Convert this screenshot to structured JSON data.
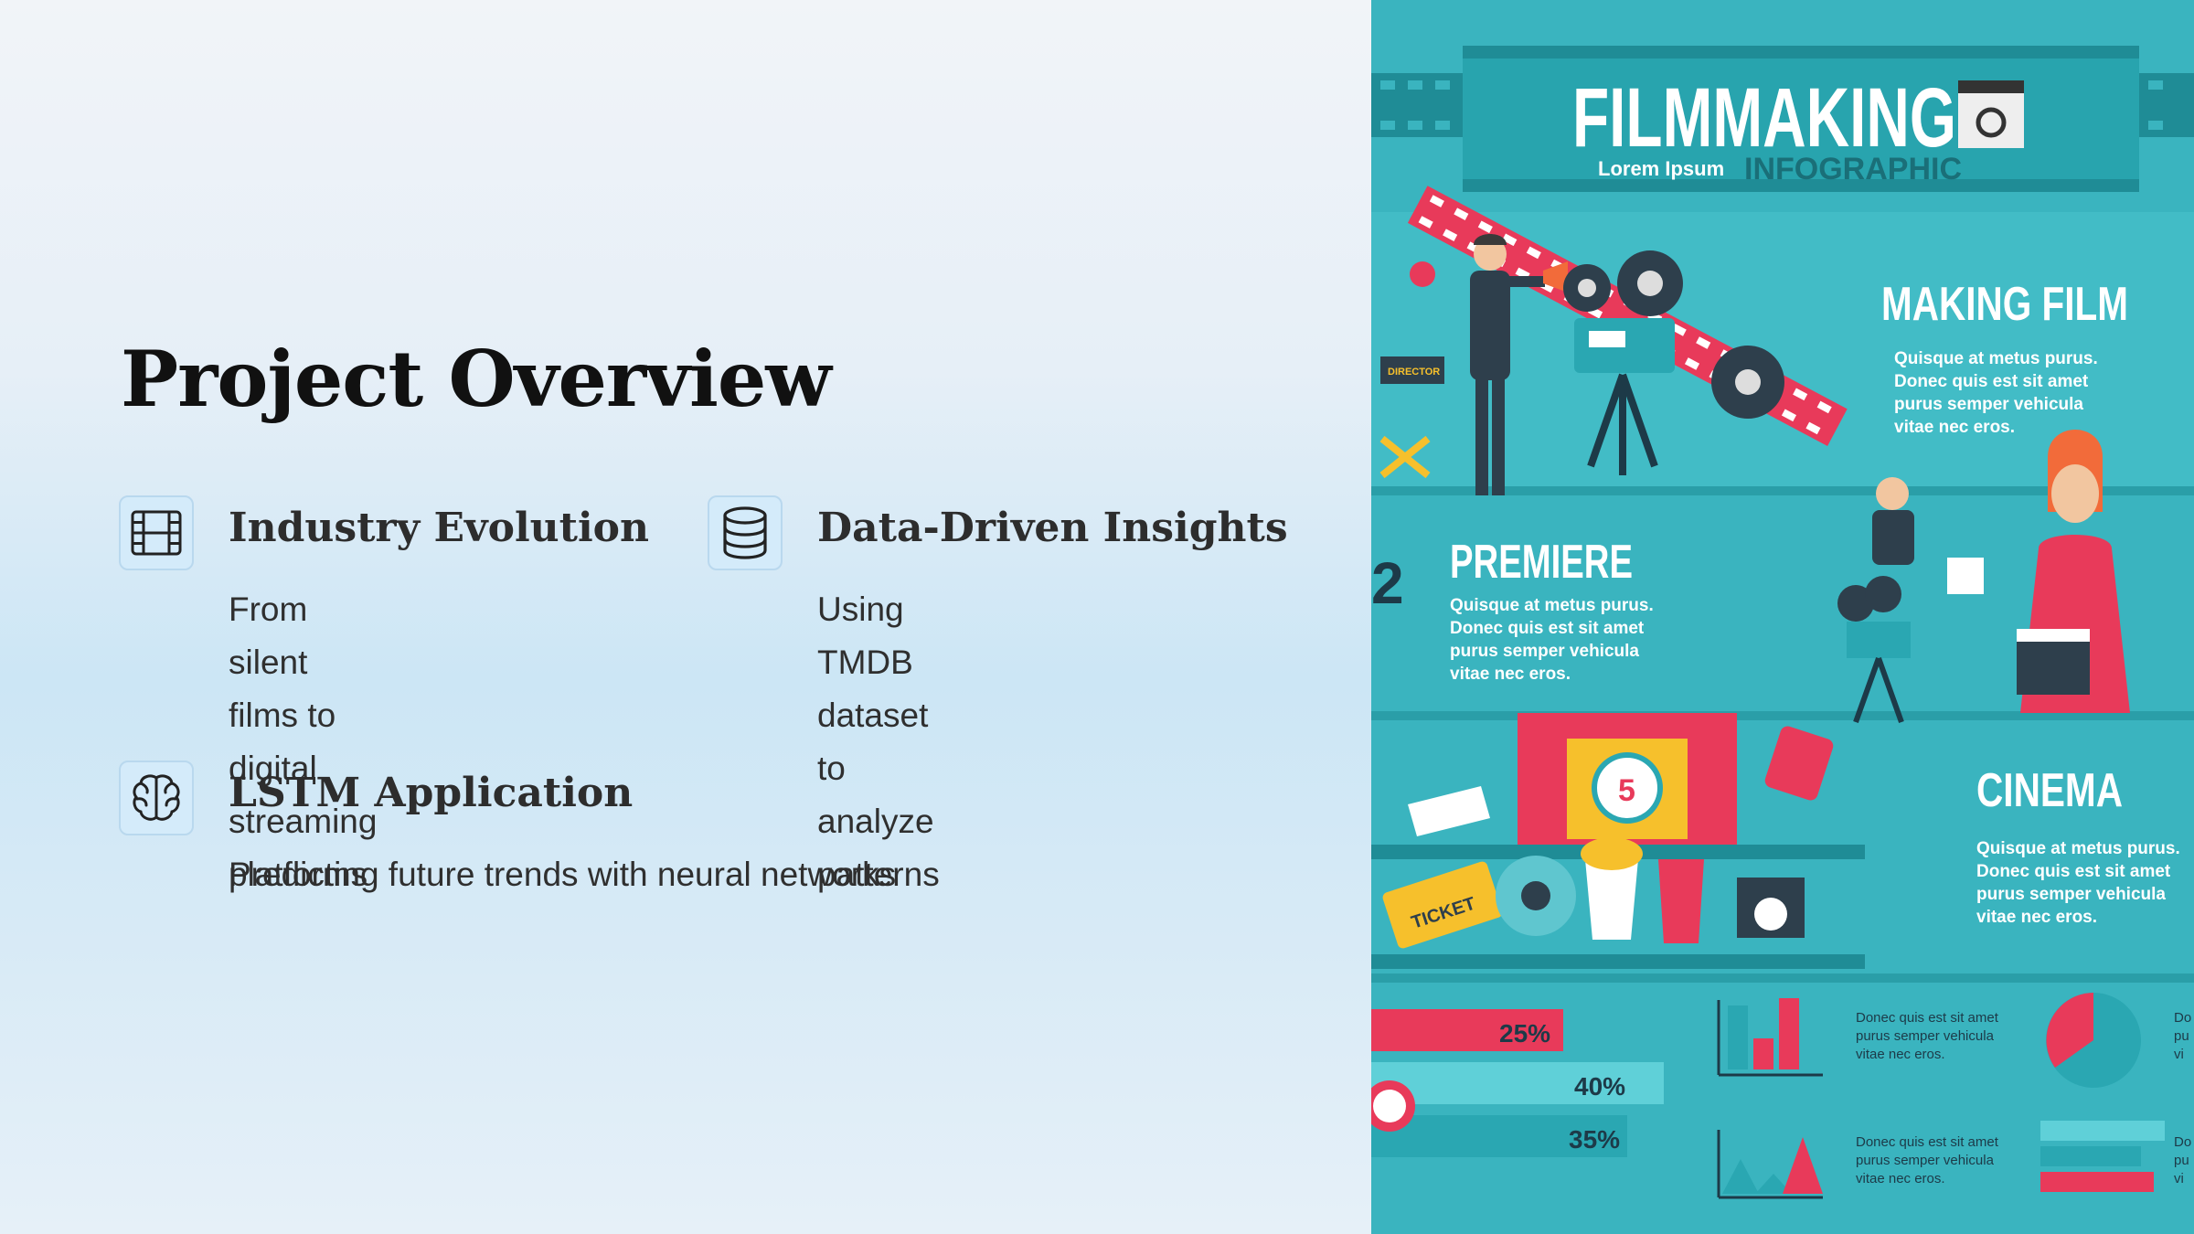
{
  "title": "Project Overview",
  "features": [
    {
      "icon": "film-icon",
      "title": "Industry Evolution",
      "desc_line1": "From silent films to digital",
      "desc_line2": "streaming platforms"
    },
    {
      "icon": "database-icon",
      "title": "Data-Driven Insights",
      "desc_line1": "Using TMDB dataset to",
      "desc_line2": "analyze patterns"
    },
    {
      "icon": "brain-icon",
      "title": "LSTM Application",
      "desc_line1": "Predicting future trends with neural networks"
    }
  ],
  "infographic": {
    "title": "FILMMAKING",
    "subtitle": "INFOGRAPHIC",
    "tagline": "Lorem Ipsum",
    "director_label": "DIRECTOR",
    "section_making": "MAKING FILM",
    "section_premiere": "PREMIERE",
    "section_cinema": "CINEMA",
    "section_number": "2",
    "lorem_l1": "Quisque at metus purus.",
    "lorem_l2": "Donec quis est sit amet",
    "lorem_l3": "purus semper vehicula",
    "lorem_l4": "vitae nec eros.",
    "small_l1": "Donec quis est sit amet",
    "small_l2": "purus semper vehicula",
    "small_l3": "vitae nec eros.",
    "ticket": "TICKET",
    "countdown": "5",
    "pct1": "25%",
    "pct2": "40%",
    "pct3": "35%",
    "pct_values": [
      25,
      40,
      35
    ],
    "edge_do": "Do",
    "edge_pu": "pu",
    "edge_vi": "vi"
  },
  "colors": {
    "teal": "#3ab4bf",
    "dark_teal": "#1f8c96",
    "red": "#e83a5a",
    "orange": "#f26b3a",
    "yellow": "#f6c02c"
  }
}
